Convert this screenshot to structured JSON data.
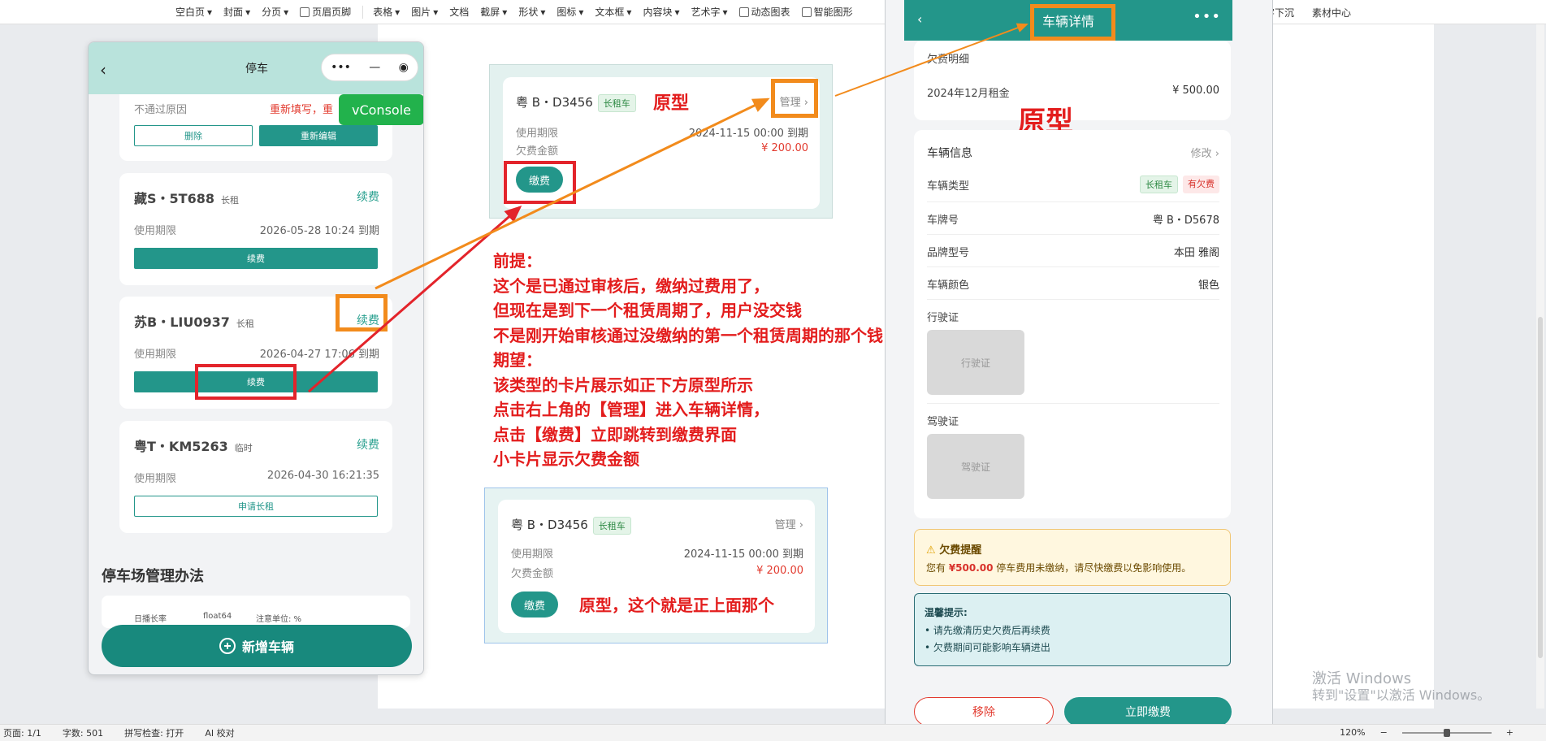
{
  "toolbar": {
    "items": [
      "空白页",
      "封面",
      "分页",
      "页眉页脚",
      "表格",
      "图片",
      "文档",
      "截屏",
      "形状",
      "图标",
      "文本框",
      "内容块",
      "艺术字",
      "动态图表",
      "智能图形"
    ],
    "right_items": [
      "字下沉",
      "素材中心"
    ]
  },
  "statusbar": {
    "page": "页面: 1/1",
    "words": "字数: 501",
    "spell": "拼写检查: 打开",
    "ai": "AI 校对",
    "zoom": "120%",
    "zoom_level": 0.5
  },
  "phone1": {
    "title": "停车",
    "capsule": {
      "more": "•••",
      "min": "—",
      "close": "◉"
    },
    "card0": {
      "reason_label": "不通过原因",
      "reason_value": "重新填写，重",
      "delete": "删除",
      "reedit": "重新编辑"
    },
    "vconsole": "vConsole",
    "cards": [
      {
        "plate": "藏S・5T688",
        "type": "长租",
        "action": "续费",
        "label": "使用期限",
        "value": "2026-05-28 10:24 到期",
        "button": "续费"
      },
      {
        "plate": "苏B・LIU0937",
        "type": "长租",
        "action": "续费",
        "label": "使用期限",
        "value": "2026-04-27 17:06 到期",
        "button": "续费"
      },
      {
        "plate": "粤T・KM5263",
        "type": "临时",
        "action": "续费",
        "label": "使用期限",
        "value": "2026-04-30 16:21:35",
        "button": "申请长租"
      }
    ],
    "section_title": "停车场管理办法",
    "table_cols": [
      "日播长率",
      "float64",
      "注意单位: %"
    ],
    "add_button": "新增车辆"
  },
  "proto_top": {
    "plate": "粤 B・D3456",
    "tag": "长租车",
    "manage": "管理 ›",
    "label_period": "使用期限",
    "value_period": "2024-11-15 00:00 到期",
    "label_debt": "欠费金额",
    "value_debt": "¥ 200.00",
    "pay": "缴费",
    "annotation": "原型"
  },
  "proto_bottom": {
    "plate": "粤 B・D3456",
    "tag": "长租车",
    "manage": "管理 ›",
    "label_period": "使用期限",
    "value_period": "2024-11-15 00:00 到期",
    "label_debt": "欠费金额",
    "value_debt": "¥ 200.00",
    "pay": "缴费",
    "annotation": "原型，这个就是正上面那个"
  },
  "note_lines": [
    "前提：",
    "这个是已通过审核后，缴纳过费用了，",
    "但现在是到下一个租赁周期了，用户没交钱",
    "不是刚开始审核通过没缴纳的第一个租赁周期的那个钱",
    "期望：",
    "该类型的卡片展示如正下方原型所示",
    "点击右上角的【管理】进入车辆详情，",
    "点击【缴费】立即跳转到缴费界面",
    "小卡片显示欠费金额"
  ],
  "phone2": {
    "title": "车辆详情",
    "more": "•••",
    "debt_section": "欠费明细",
    "debt_item": "2024年12月租金",
    "debt_amount": "¥ 500.00",
    "annotation": "原型",
    "info_title": "车辆信息",
    "edit": "修改 ›",
    "rows": [
      {
        "label": "车辆类型",
        "value": ""
      },
      {
        "label": "车牌号",
        "value": "粤 B・D5678"
      },
      {
        "label": "品牌型号",
        "value": "本田 雅阁"
      },
      {
        "label": "车辆颜色",
        "value": "银色"
      }
    ],
    "type_tags": [
      "长租车",
      "有欠费"
    ],
    "license_label": "行驶证",
    "license_ph": "行驶证",
    "driver_label": "驾驶证",
    "driver_ph": "驾驶证",
    "warn_title": "欠费提醒",
    "warn_pre": "您有 ",
    "warn_amount": "¥500.00",
    "warn_post": " 停车费用未缴纳，请尽快缴费以免影响使用。",
    "tips_title": "温馨提示:",
    "tips": [
      "• 请先缴清历史欠费后再续费",
      "• 欠费期间可能影响车辆进出"
    ],
    "remove": "移除",
    "pay_now": "立即缴费"
  },
  "watermark": {
    "line1": "激活 Windows",
    "line2": "转到\"设置\"以激活 Windows。"
  },
  "colors": {
    "primary": "#23968a",
    "red": "#e31d1d",
    "orange": "#f28b1c"
  }
}
